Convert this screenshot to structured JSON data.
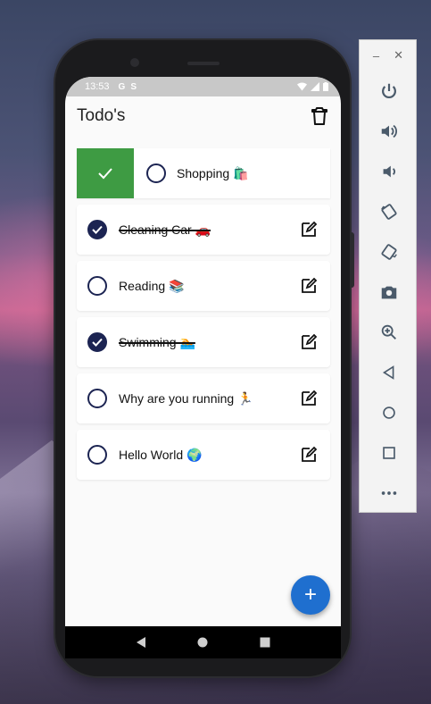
{
  "status_bar": {
    "time": "13:53",
    "icon_a": "G",
    "icon_b": "S"
  },
  "app_bar": {
    "title": "Todo's"
  },
  "todos": [
    {
      "label": "Shopping 🛍️",
      "done": false,
      "swiped": true
    },
    {
      "label": "Cleaning Car 🚗",
      "done": true
    },
    {
      "label": "Reading 📚",
      "done": false
    },
    {
      "label": "Swimming 🏊",
      "done": true
    },
    {
      "label": "Why are you running 🏃",
      "done": false
    },
    {
      "label": "Hello World 🌍",
      "done": false
    }
  ],
  "fab": {
    "symbol": "+"
  },
  "emulator_toolbar": {
    "minimize": "–",
    "close": "✕",
    "buttons": [
      "power-icon",
      "volume-up-icon",
      "volume-down-icon",
      "rotate-left-icon",
      "rotate-right-icon",
      "camera-icon",
      "zoom-icon",
      "back-icon",
      "home-icon",
      "overview-icon",
      "more-icon"
    ]
  },
  "colors": {
    "accent": "#1f6fcf",
    "check": "#1c2452",
    "swipe": "#3e9b43"
  }
}
